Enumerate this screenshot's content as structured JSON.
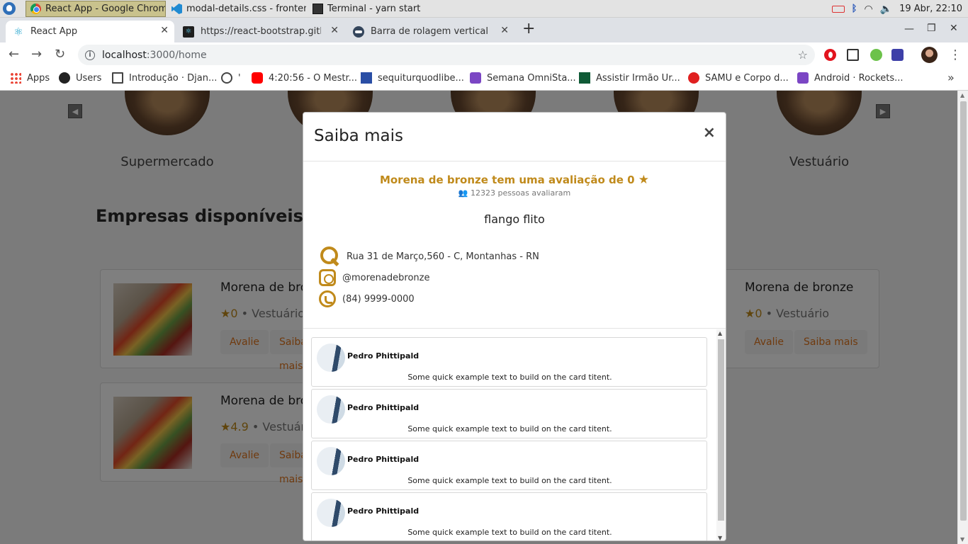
{
  "taskbar": {
    "tasks": [
      "React App - Google Chrome",
      "modal-details.css - fronten...",
      "Terminal - yarn start"
    ],
    "datetime": "19 Abr, 22:10"
  },
  "browser": {
    "tabs": [
      {
        "title": "React App"
      },
      {
        "title": "https://react-bootstrap.githu"
      },
      {
        "title": "Barra de rolagem vertical nao"
      }
    ],
    "url_host": "localhost",
    "url_path": ":3000/home",
    "bookmarks": [
      "Apps",
      "Users",
      "Introdução · Djan...",
      "'",
      "4:20:56 - O Mestr...",
      "sequiturquodlibe...",
      "Semana OmniSta...",
      "Assistir Irmão Ur...",
      "SAMU e Corpo d...",
      "Android · Rockets..."
    ]
  },
  "page": {
    "categories": [
      "Supermercado",
      "Vestuário"
    ],
    "section_title": "Empresas disponíveis",
    "cards": [
      {
        "name": "Morena de bronze",
        "rating": "0",
        "category": "Vestuário",
        "btn_rate": "Avalie",
        "btn_more": "Saiba mais"
      },
      {
        "name": "Morena de bronze",
        "rating": "0",
        "category": "Vestuário",
        "btn_rate": "Avalie",
        "btn_more": "Saiba mais"
      },
      {
        "name": "Morena de bronze",
        "rating": "4.9",
        "category": "Vestuário",
        "btn_rate": "Avalie",
        "btn_more": "Saiba mais"
      }
    ]
  },
  "modal": {
    "title": "Saiba mais",
    "close": "×",
    "rating_headline": "Morena de bronze tem uma avaliação de 0",
    "rating_count": "12323 pessoas avaliaram",
    "description": "flango flito",
    "address": "Rua 31 de Março,560 - C, Montanhas - RN",
    "instagram": "@morenadebronze",
    "phone": "(84) 9999-0000",
    "reviews": [
      {
        "name": "Pedro Phittipald",
        "text": "Some quick example text to build on the card titent."
      },
      {
        "name": "Pedro Phittipald",
        "text": "Some quick example text to build on the card titent."
      },
      {
        "name": "Pedro Phittipald",
        "text": "Some quick example text to build on the card titent."
      },
      {
        "name": "Pedro Phittipald",
        "text": "Some quick example text to build on the card titent."
      }
    ]
  },
  "colors": {
    "accent": "#c08a1b",
    "button_text": "#e0751c",
    "overlay": "rgba(0,0,0,0.5)"
  }
}
